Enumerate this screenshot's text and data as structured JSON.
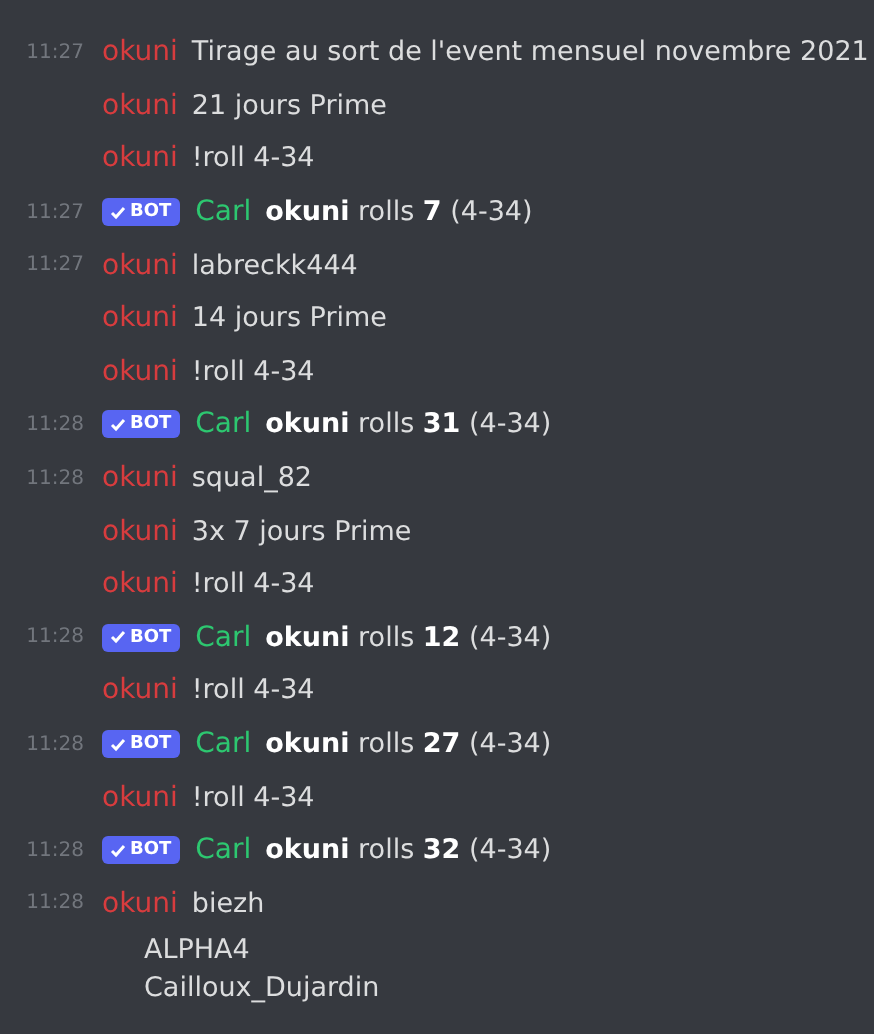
{
  "messages": [
    {
      "time": "11:27",
      "kind": "user",
      "author": "okuni",
      "color": "#d83c3e",
      "lines": [
        "Tirage au sort de l'event mensuel novembre 2021"
      ]
    },
    {
      "kind": "user",
      "author": "okuni",
      "color": "#d83c3e",
      "lines": [
        "21 jours Prime"
      ]
    },
    {
      "kind": "user",
      "author": "okuni",
      "color": "#d83c3e",
      "lines": [
        "!roll 4-34"
      ]
    },
    {
      "time": "11:27",
      "kind": "bot",
      "badge": "BOT",
      "author": "Carl",
      "color": "#2dc770",
      "lines": [
        "**okuni** rolls **7** (4-34)"
      ]
    },
    {
      "time": "11:27",
      "kind": "user",
      "author": "okuni",
      "color": "#d83c3e",
      "lines": [
        "labreckk444"
      ]
    },
    {
      "kind": "user",
      "author": "okuni",
      "color": "#d83c3e",
      "lines": [
        "14 jours Prime"
      ]
    },
    {
      "kind": "user",
      "author": "okuni",
      "color": "#d83c3e",
      "lines": [
        "!roll 4-34"
      ]
    },
    {
      "time": "11:28",
      "kind": "bot",
      "badge": "BOT",
      "author": "Carl",
      "color": "#2dc770",
      "lines": [
        "**okuni** rolls **31** (4-34)"
      ]
    },
    {
      "time": "11:28",
      "kind": "user",
      "author": "okuni",
      "color": "#d83c3e",
      "lines": [
        "squal_82"
      ]
    },
    {
      "kind": "user",
      "author": "okuni",
      "color": "#d83c3e",
      "lines": [
        "3x 7 jours Prime"
      ]
    },
    {
      "kind": "user",
      "author": "okuni",
      "color": "#d83c3e",
      "lines": [
        "!roll 4-34"
      ]
    },
    {
      "time": "11:28",
      "kind": "bot",
      "badge": "BOT",
      "author": "Carl",
      "color": "#2dc770",
      "lines": [
        "**okuni** rolls **12** (4-34)"
      ]
    },
    {
      "kind": "user",
      "author": "okuni",
      "color": "#d83c3e",
      "lines": [
        "!roll 4-34"
      ]
    },
    {
      "time": "11:28",
      "kind": "bot",
      "badge": "BOT",
      "author": "Carl",
      "color": "#2dc770",
      "lines": [
        "**okuni** rolls **27** (4-34)"
      ]
    },
    {
      "kind": "user",
      "author": "okuni",
      "color": "#d83c3e",
      "lines": [
        "!roll 4-34"
      ]
    },
    {
      "time": "11:28",
      "kind": "bot",
      "badge": "BOT",
      "author": "Carl",
      "color": "#2dc770",
      "lines": [
        "**okuni** rolls **32** (4-34)"
      ]
    },
    {
      "time": "11:28",
      "kind": "user",
      "author": "okuni",
      "color": "#d83c3e",
      "lines": [
        "biezh",
        "ALPHA4",
        "Cailloux_Dujardin"
      ]
    }
  ]
}
